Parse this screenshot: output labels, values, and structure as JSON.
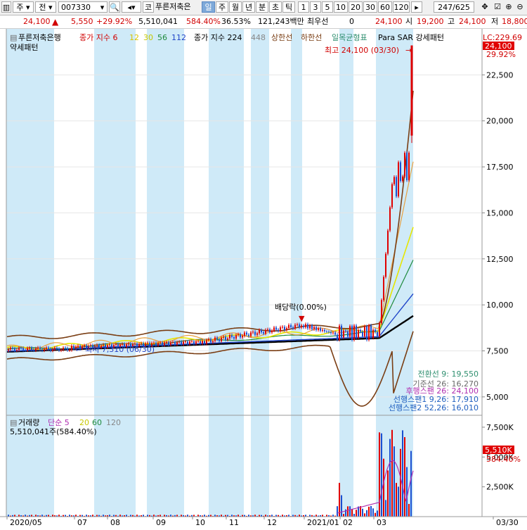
{
  "toolbar": {
    "market": "주",
    "type": "전",
    "code": "007330",
    "currency_tag": "코",
    "stock_name": "푸른저축은",
    "periods": [
      "일",
      "주",
      "월",
      "년",
      "분",
      "초",
      "틱"
    ],
    "selected_period": "일",
    "intervals": [
      "1",
      "3",
      "5",
      "10",
      "20",
      "30",
      "60",
      "120"
    ],
    "page_counter": "247/625"
  },
  "quote": {
    "price": "24,100",
    "change": "5,550",
    "change_rate": "+29.92%",
    "volume": "5,510,041",
    "volume_rate": "584.40%",
    "turnover": "36.53%",
    "amount": "121,243백만",
    "pref_label": "최우선",
    "pref_value": "0",
    "last": "24,100",
    "open_label": "시",
    "open": "19,200",
    "high_label": "고",
    "high": "24,100",
    "low_label": "저",
    "low": "18,800"
  },
  "legend_price": {
    "name": "푸른저축은행",
    "ma_label": "종가 지수 6",
    "ma12": "12",
    "ma30": "30",
    "ma56": "56",
    "ma112": "112",
    "ma224_label": "종가 지수 224",
    "ma448": "448",
    "upper": "상한선",
    "lower": "하한선",
    "ichimoku": "일목균형표",
    "sar": "Para SAR 강세패턴",
    "pattern": "약세패턴",
    "lc_label": "LC:229.69"
  },
  "annotations": {
    "high_note": "최고 24,100 (03/30)",
    "low_note": "최저 7,310 (06/30)",
    "dividend": "배당락(0.00%)",
    "price_tag": "24,100",
    "price_tag_rate": "29.92%"
  },
  "ichimoku_legend": [
    {
      "text": "전환선 9: 19,550",
      "color": "#2f8f6f"
    },
    {
      "text": "기준선 26: 16,270",
      "color": "#6a6a6a"
    },
    {
      "text": "후행스팬 26: 24,100",
      "color": "#b02fb0"
    },
    {
      "text": "선행스팬1 9,26: 17,910",
      "color": "#2060c0"
    },
    {
      "text": "선행스팬2 52,26: 16,010",
      "color": "#2060c0"
    }
  ],
  "volume_legend": {
    "name": "거래량",
    "simple": "단순 5",
    "ma20": "20",
    "ma60": "60",
    "ma120": "120",
    "value": "5,510,041주(584.40%)",
    "tag": "5,510K",
    "tag_rate": "584.40%"
  },
  "colors": {
    "up": "#e00000",
    "down": "#1a4fd0",
    "shade": "#cfeaf8"
  },
  "chart_data": {
    "type": "candlestick",
    "price_axis": {
      "min": 4000,
      "max": 25000,
      "ticks": [
        22500,
        20000,
        17500,
        15000,
        12500,
        10000,
        7500,
        5000
      ]
    },
    "volume_axis": {
      "min": 0,
      "max": 8500000,
      "ticks": [
        "7,500K",
        "5,000K",
        "2,500K"
      ],
      "tick_values": [
        7500000,
        5000000,
        2500000
      ]
    },
    "x_ticks": [
      "2020/05",
      "07",
      "08",
      "09",
      "10",
      "11",
      "12",
      "2021/01",
      "02",
      "03",
      "03/30"
    ],
    "high": 24100,
    "high_date": "03/30",
    "low": 7310,
    "low_date": "06/30",
    "last": 24100
  }
}
